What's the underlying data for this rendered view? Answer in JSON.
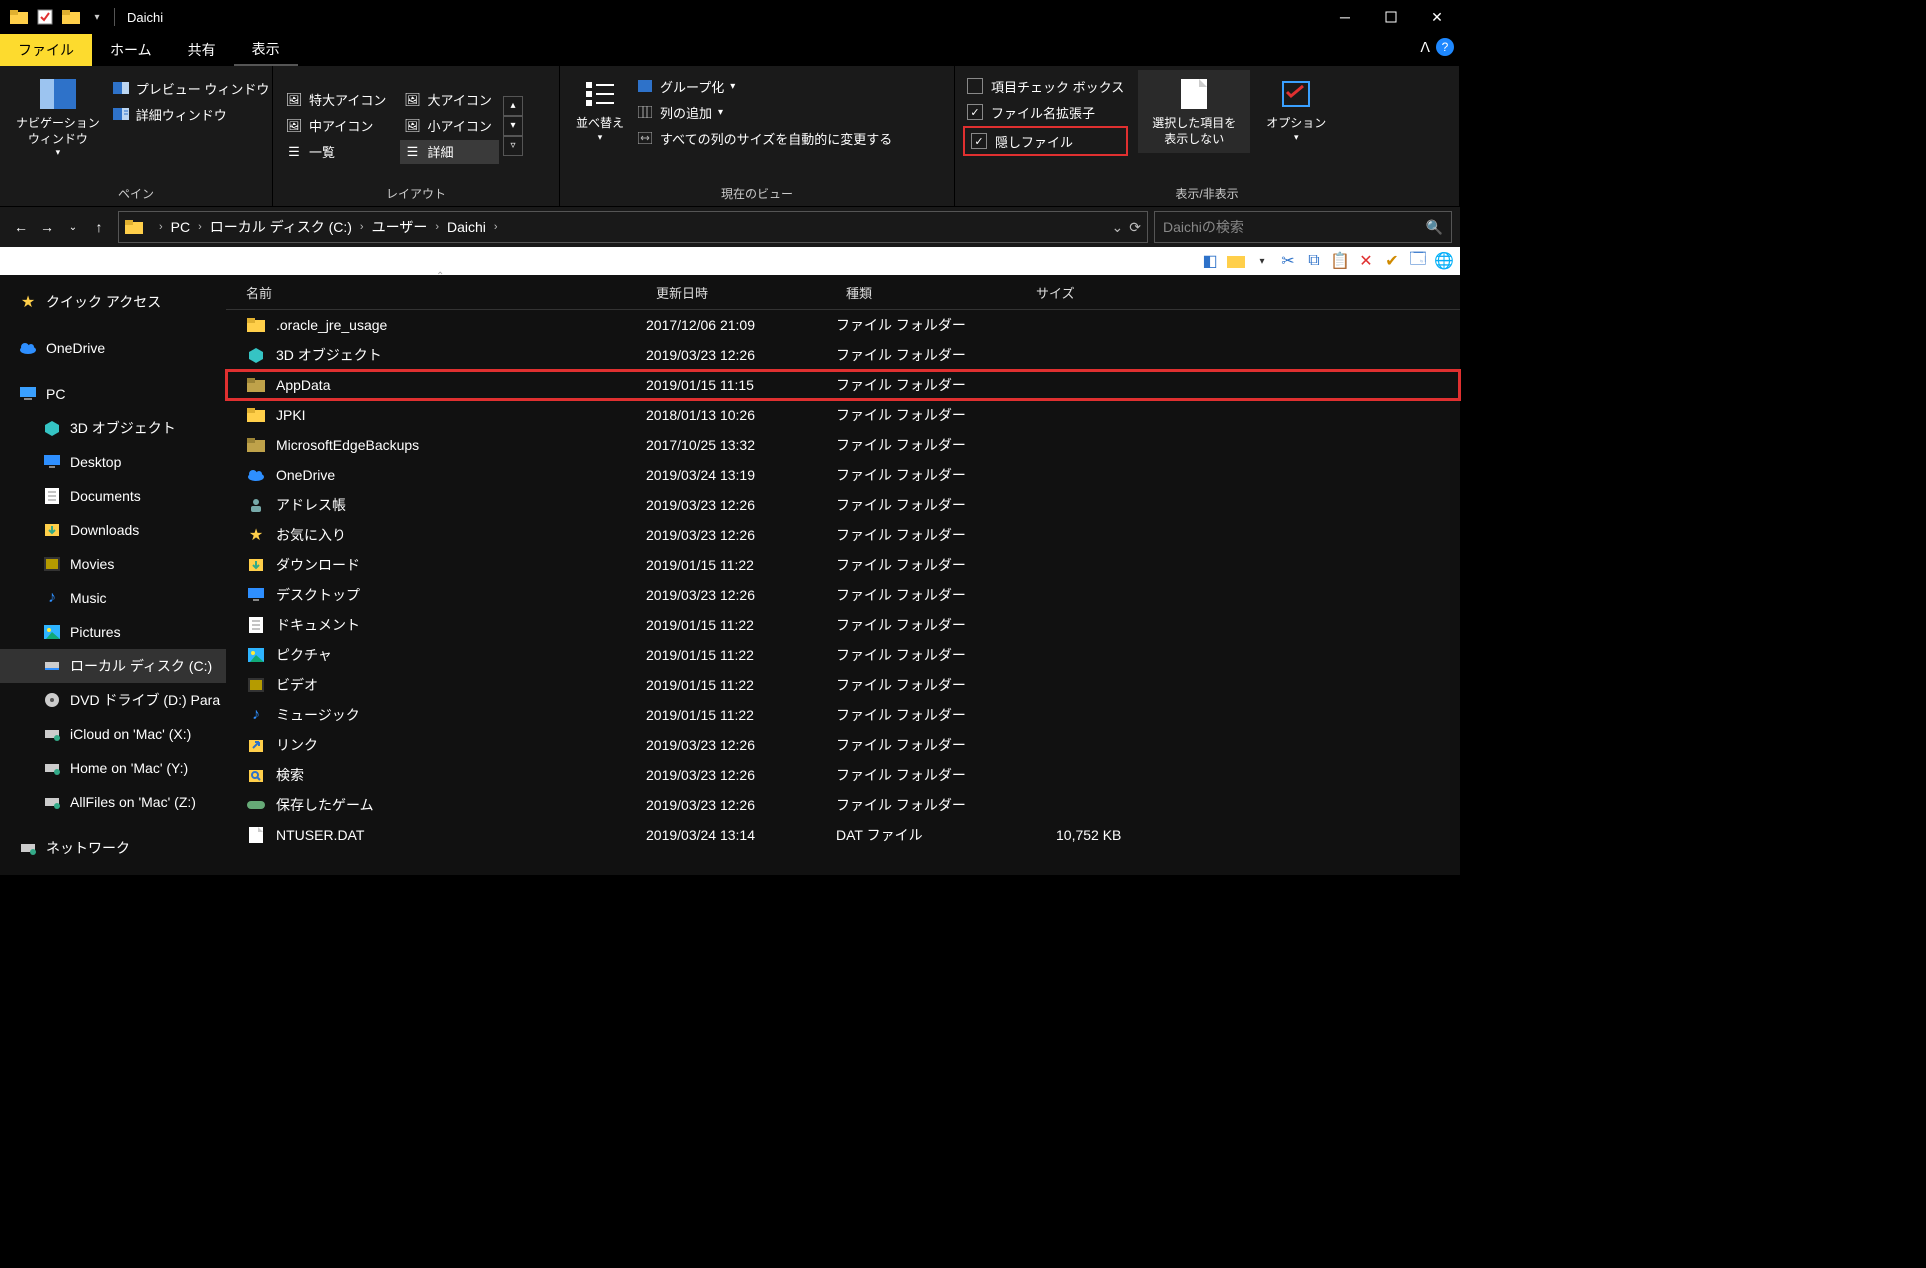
{
  "window": {
    "title": "Daichi"
  },
  "tabs": {
    "file": "ファイル",
    "home": "ホーム",
    "share": "共有",
    "view": "表示"
  },
  "ribbon": {
    "pane": {
      "label": "ペイン",
      "nav": "ナビゲーション\nウィンドウ",
      "preview": "プレビュー ウィンドウ",
      "details": "詳細ウィンドウ"
    },
    "layout": {
      "label": "レイアウト",
      "xl": "特大アイコン",
      "l": "大アイコン",
      "m": "中アイコン",
      "s": "小アイコン",
      "list": "一覧",
      "det": "詳細"
    },
    "view": {
      "label": "現在のビュー",
      "sort": "並べ替え",
      "group": "グループ化",
      "addcol": "列の追加",
      "autosize": "すべての列のサイズを自動的に変更する"
    },
    "show": {
      "label": "表示/非表示",
      "itemcb": "項目チェック ボックス",
      "ext": "ファイル名拡張子",
      "hidden": "隠しファイル",
      "hidesel": "選択した項目を\n表示しない",
      "options": "オプション"
    }
  },
  "breadcrumb": [
    "PC",
    "ローカル ディスク (C:)",
    "ユーザー",
    "Daichi"
  ],
  "search": {
    "placeholder": "Daichiの検索"
  },
  "columns": {
    "name": "名前",
    "date": "更新日時",
    "type": "種類",
    "size": "サイズ"
  },
  "sidebar": [
    {
      "label": "クイック アクセス",
      "lvl": 1,
      "icon": "star",
      "color": "#2e8fff"
    },
    {
      "label": "OneDrive",
      "lvl": 1,
      "icon": "cloud",
      "color": "#2e8fff"
    },
    {
      "label": "PC",
      "lvl": 1,
      "icon": "pc",
      "color": "#3aa0ff"
    },
    {
      "label": "3D オブジェクト",
      "lvl": 2,
      "icon": "cube",
      "color": "#35c4c4"
    },
    {
      "label": "Desktop",
      "lvl": 2,
      "icon": "desktop",
      "color": "#2e8fff"
    },
    {
      "label": "Documents",
      "lvl": 2,
      "icon": "doc",
      "color": "#fff"
    },
    {
      "label": "Downloads",
      "lvl": 2,
      "icon": "down",
      "color": "#3aa0ff"
    },
    {
      "label": "Movies",
      "lvl": 2,
      "icon": "movie",
      "color": "#b59b00"
    },
    {
      "label": "Music",
      "lvl": 2,
      "icon": "music",
      "color": "#2e8fff"
    },
    {
      "label": "Pictures",
      "lvl": 2,
      "icon": "pic",
      "color": "#2eb4ff"
    },
    {
      "label": "ローカル ディスク (C:)",
      "lvl": 2,
      "icon": "disk",
      "color": "#bbb",
      "sel": true
    },
    {
      "label": "DVD ドライブ (D:) Para",
      "lvl": 2,
      "icon": "dvd",
      "color": "#bbb"
    },
    {
      "label": "iCloud on 'Mac' (X:)",
      "lvl": 2,
      "icon": "net",
      "color": "#bbb"
    },
    {
      "label": "Home on 'Mac' (Y:)",
      "lvl": 2,
      "icon": "net",
      "color": "#bbb"
    },
    {
      "label": "AllFiles on 'Mac' (Z:)",
      "lvl": 2,
      "icon": "net",
      "color": "#bbb"
    },
    {
      "label": "ネットワーク",
      "lvl": 1,
      "icon": "net",
      "color": "#3aa0ff"
    }
  ],
  "files": [
    {
      "name": ".oracle_jre_usage",
      "date": "2017/12/06 21:09",
      "type": "ファイル フォルダー",
      "size": "",
      "icon": "folder",
      "hl": false
    },
    {
      "name": "3D オブジェクト",
      "date": "2019/03/23 12:26",
      "type": "ファイル フォルダー",
      "size": "",
      "icon": "cube",
      "hl": false
    },
    {
      "name": "AppData",
      "date": "2019/01/15 11:15",
      "type": "ファイル フォルダー",
      "size": "",
      "icon": "folder-dim",
      "hl": true
    },
    {
      "name": "JPKI",
      "date": "2018/01/13 10:26",
      "type": "ファイル フォルダー",
      "size": "",
      "icon": "folder",
      "hl": false
    },
    {
      "name": "MicrosoftEdgeBackups",
      "date": "2017/10/25 13:32",
      "type": "ファイル フォルダー",
      "size": "",
      "icon": "folder-dim",
      "hl": false
    },
    {
      "name": "OneDrive",
      "date": "2019/03/24 13:19",
      "type": "ファイル フォルダー",
      "size": "",
      "icon": "cloud",
      "hl": false
    },
    {
      "name": "アドレス帳",
      "date": "2019/03/23 12:26",
      "type": "ファイル フォルダー",
      "size": "",
      "icon": "contacts",
      "hl": false
    },
    {
      "name": "お気に入り",
      "date": "2019/03/23 12:26",
      "type": "ファイル フォルダー",
      "size": "",
      "icon": "star",
      "hl": false
    },
    {
      "name": "ダウンロード",
      "date": "2019/01/15 11:22",
      "type": "ファイル フォルダー",
      "size": "",
      "icon": "down",
      "hl": false
    },
    {
      "name": "デスクトップ",
      "date": "2019/03/23 12:26",
      "type": "ファイル フォルダー",
      "size": "",
      "icon": "desktop",
      "hl": false
    },
    {
      "name": "ドキュメント",
      "date": "2019/01/15 11:22",
      "type": "ファイル フォルダー",
      "size": "",
      "icon": "doc",
      "hl": false
    },
    {
      "name": "ピクチャ",
      "date": "2019/01/15 11:22",
      "type": "ファイル フォルダー",
      "size": "",
      "icon": "pic",
      "hl": false
    },
    {
      "name": "ビデオ",
      "date": "2019/01/15 11:22",
      "type": "ファイル フォルダー",
      "size": "",
      "icon": "movie",
      "hl": false
    },
    {
      "name": "ミュージック",
      "date": "2019/01/15 11:22",
      "type": "ファイル フォルダー",
      "size": "",
      "icon": "music",
      "hl": false
    },
    {
      "name": "リンク",
      "date": "2019/03/23 12:26",
      "type": "ファイル フォルダー",
      "size": "",
      "icon": "link",
      "hl": false
    },
    {
      "name": "検索",
      "date": "2019/03/23 12:26",
      "type": "ファイル フォルダー",
      "size": "",
      "icon": "search",
      "hl": false
    },
    {
      "name": "保存したゲーム",
      "date": "2019/03/23 12:26",
      "type": "ファイル フォルダー",
      "size": "",
      "icon": "game",
      "hl": false
    },
    {
      "name": "NTUSER.DAT",
      "date": "2019/03/24 13:14",
      "type": "DAT ファイル",
      "size": "10,752 KB",
      "icon": "file",
      "hl": false
    }
  ]
}
